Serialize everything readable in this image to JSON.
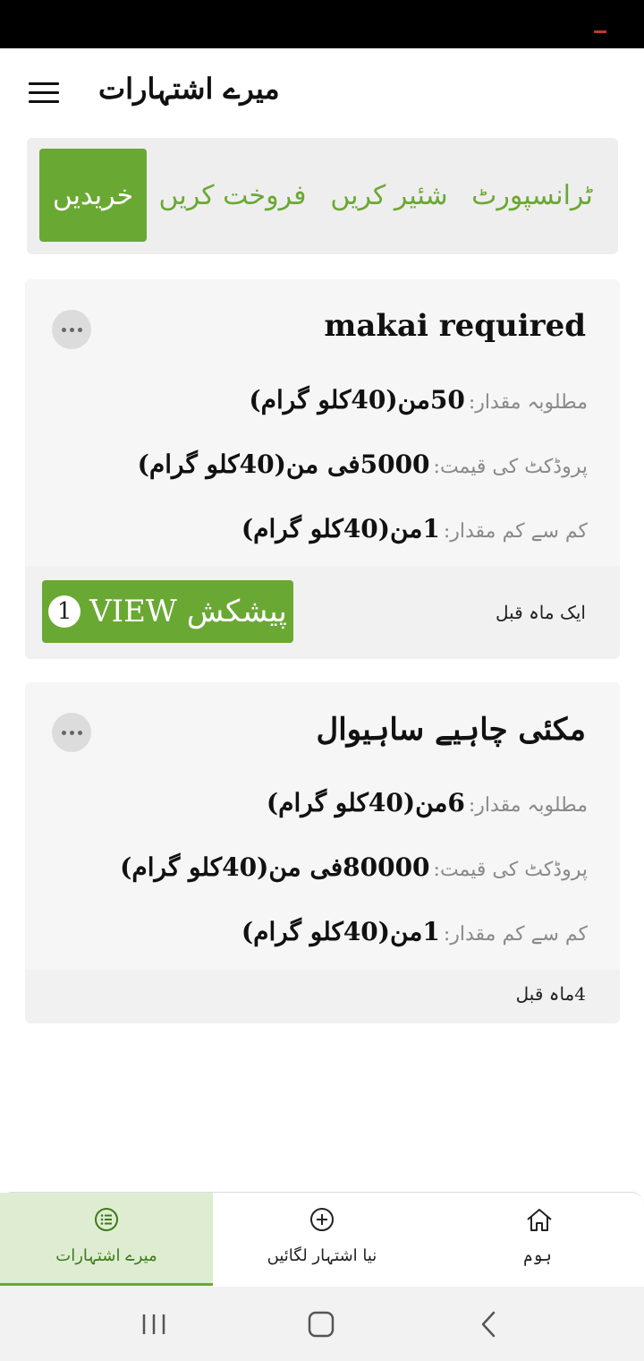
{
  "header": {
    "title": "میرے اشتہارات"
  },
  "tabs": [
    {
      "label": "خریدیں",
      "active": true
    },
    {
      "label": "فروخت کریں",
      "active": false
    },
    {
      "label": "شئیر کریں",
      "active": false
    },
    {
      "label": "ٹرانسپورٹ",
      "active": false
    }
  ],
  "ads": [
    {
      "title": "makai required",
      "details": [
        {
          "label": "مطلوبہ مقدار:",
          "value": "50من(40کلو گرام)"
        },
        {
          "label": "پروڈکٹ کی قیمت:",
          "value": "5000فی من(40کلو گرام)"
        },
        {
          "label": "کم سے کم مقدار:",
          "value": "1من(40کلو گرام)"
        }
      ],
      "time_ago": "ایک ماہ قبل",
      "view_button": {
        "label": "VIEW پیشکش",
        "offer_count": "1"
      }
    },
    {
      "title": "مکئی چاہیے ساہیوال",
      "details": [
        {
          "label": "مطلوبہ مقدار:",
          "value": "6من(40کلو گرام)"
        },
        {
          "label": "پروڈکٹ کی قیمت:",
          "value": "80000فی من(40کلو گرام)"
        },
        {
          "label": "کم سے کم مقدار:",
          "value": "1من(40کلو گرام)"
        }
      ],
      "time_ago": "4ماہ قبل"
    }
  ],
  "bottom_nav": [
    {
      "label": "میرے اشتہارات",
      "icon": "list-icon",
      "active": true
    },
    {
      "label": "نیا اشتہار لگائیں",
      "icon": "plus-circle-icon",
      "active": false
    },
    {
      "label": "ہوم",
      "icon": "home-icon",
      "active": false
    }
  ],
  "colors": {
    "accent": "#6aa834",
    "active_nav_bg": "#deedd2",
    "card_bg": "#f6f6f6"
  }
}
